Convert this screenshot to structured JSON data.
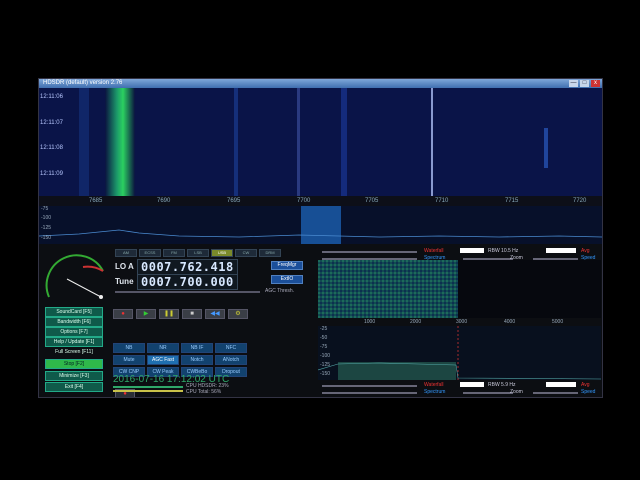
{
  "window": {
    "title": "HDSDR (default) version 2.76",
    "btn_min": "—",
    "btn_max": "□",
    "btn_close": "x"
  },
  "waterfall": {
    "times": [
      "12:11:06",
      "12:11:07",
      "12:11:08",
      "12:11:09"
    ]
  },
  "freq_axis": {
    "ticks": [
      "7685",
      "7690",
      "7695",
      "7700",
      "7705",
      "7710",
      "7715",
      "7720"
    ]
  },
  "spectrum": {
    "db_labels": [
      "-75",
      "-100",
      "-125",
      "-150"
    ]
  },
  "mode_buttons": [
    {
      "label": "AM",
      "on": false
    },
    {
      "label": "ECSS",
      "on": false
    },
    {
      "label": "FM",
      "on": false
    },
    {
      "label": "LSB",
      "on": false
    },
    {
      "label": "USB",
      "on": true
    },
    {
      "label": "CW",
      "on": false
    },
    {
      "label": "DRM",
      "on": false
    }
  ],
  "lo": {
    "label": "LO A",
    "value": "0007.762.418"
  },
  "tune": {
    "label": "Tune",
    "value": "0007.700.000"
  },
  "freqmgr_label": "FreqMgr",
  "extio_label": "ExtIO",
  "agc_label": "AGC Thresh.",
  "side_buttons": [
    {
      "label": "SoundCard [F5]",
      "play": false
    },
    {
      "label": "Bandwidth [F6]",
      "play": false
    },
    {
      "label": "Options [F7]",
      "play": false
    },
    {
      "label": "Help / Update [F1]",
      "play": false
    },
    {
      "label": "Full Screen [F11]",
      "play": false
    },
    {
      "label": "Stop [F2]",
      "play": true
    },
    {
      "label": "Minimize [F3]",
      "play": false
    },
    {
      "label": "Exit [F4]",
      "play": false
    }
  ],
  "tape_buttons": [
    "●",
    "▶",
    "❚❚",
    "■",
    "◀◀",
    "⚙"
  ],
  "dsp_buttons": [
    {
      "label": "NB",
      "hl": false
    },
    {
      "label": "NR",
      "hl": false
    },
    {
      "label": "NB IF",
      "hl": false
    },
    {
      "label": "NFC",
      "hl": false
    },
    {
      "label": "Mute",
      "hl": false
    },
    {
      "label": "AGC Fast",
      "hl": true
    },
    {
      "label": "Notch",
      "hl": false
    },
    {
      "label": "ANotch",
      "hl": false
    },
    {
      "label": "CW CNP",
      "hl": false
    },
    {
      "label": "CW Peak",
      "hl": false
    },
    {
      "label": "CWBeBo",
      "hl": false
    },
    {
      "label": "Dropout",
      "hl": false
    }
  ],
  "clock": "2016-07-16  17:12:02 UTC",
  "cpu": {
    "hdsdr": "CPU HDSDR:  23%",
    "total": "CPU Total:  56%"
  },
  "top_controls": {
    "waterfall": "Waterfall",
    "rbw": "RBW  10.5 Hz",
    "avg": "Avg",
    "spectrum": "Spectrum",
    "zoom": "Zoom",
    "speed": "Speed"
  },
  "audio_axis": {
    "ticks": [
      "1000",
      "2000",
      "3000",
      "4000",
      "5000"
    ]
  },
  "audio_db": [
    "-25",
    "-50",
    "-75",
    "-100",
    "-125",
    "-150"
  ],
  "bottom_controls": {
    "waterfall": "Waterfall",
    "rbw": "RBW  5.9 Hz",
    "avg": "Avg",
    "spectrum": "Spectrum",
    "zoom": "Zoom",
    "speed": "Speed"
  },
  "colors": {
    "accent": "#1b4f9a",
    "play_green": "#2fb84a",
    "clock_green": "#2fa86a"
  }
}
